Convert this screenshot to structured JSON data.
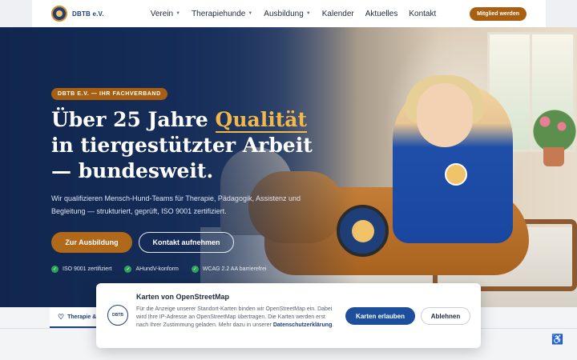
{
  "brand": {
    "name": "DBTB e.V.",
    "logo_icon": "dbtb-logo-icon"
  },
  "nav": {
    "items": [
      {
        "label": "Verein",
        "dropdown": true
      },
      {
        "label": "Therapiehunde",
        "dropdown": true
      },
      {
        "label": "Ausbildung",
        "dropdown": true
      },
      {
        "label": "Kalender",
        "dropdown": false
      },
      {
        "label": "Aktuelles",
        "dropdown": false
      },
      {
        "label": "Kontakt",
        "dropdown": false
      }
    ],
    "cta": "Mitglied werden"
  },
  "hero": {
    "eyebrow": "DBTB E.V. — IHR FACHVERBAND",
    "headline_pre": "Über 25 Jahre ",
    "headline_highlight": "Qualität",
    "headline_post": " in tiergestützter Arbeit — bundesweit.",
    "lead": "Wir qualifizieren Mensch-Hund-Teams für Therapie, Pädagogik, Assistenz und Begleitung — strukturiert, geprüft, ISO 9001 zertifiziert.",
    "primary_button": "Zur Ausbildung",
    "secondary_button": "Kontakt aufnehmen",
    "trust": [
      "ISO 9001 zertifiziert",
      "AHundV-konform",
      "WCAG 2.2 AA barrierefrei"
    ]
  },
  "tab": {
    "label": "Therapie &",
    "icon": "heart-icon"
  },
  "consent": {
    "logo_text": "DBTB",
    "title": "Karten von OpenStreetMap",
    "body": "Für die Anzeige unserer Standort-Karten binden wir OpenStreetMap ein. Dabei wird Ihre IP-Adresse an OpenStreetMap übertragen. Die Karten werden erst nach Ihrer Zustimmung geladen. Mehr dazu in unserer",
    "link": "Datenschutzerklärung",
    "allow": "Karten erlauben",
    "deny": "Ablehnen"
  },
  "colors": {
    "accent": "#a95f11",
    "brand": "#1f3f7a",
    "highlight": "#f2b94a",
    "check": "#2fa35a"
  }
}
